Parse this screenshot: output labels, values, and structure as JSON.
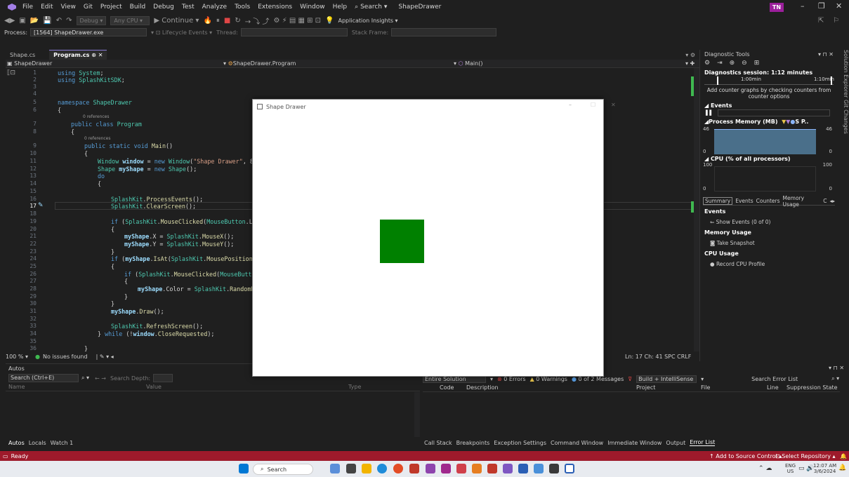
{
  "titlebar": {
    "menu": [
      "File",
      "Edit",
      "View",
      "Git",
      "Project",
      "Build",
      "Debug",
      "Test",
      "Analyze",
      "Tools",
      "Extensions",
      "Window",
      "Help"
    ],
    "search_label": "Search",
    "app_name": "ShapeDrawer",
    "avatar": "TN"
  },
  "toolbar": {
    "config": "Debug",
    "platform": "Any CPU",
    "continue_label": "Continue",
    "app_insights": "Application Insights"
  },
  "procbar": {
    "process_label": "Process:",
    "process_value": "[1564] ShapeDrawer.exe",
    "lifecycle": "Lifecycle Events",
    "thread": "Thread:",
    "stack_frame": "Stack Frame:"
  },
  "editor": {
    "tabs": [
      {
        "label": "Shape.cs"
      },
      {
        "label": "Program.cs"
      }
    ],
    "nav_project": "ShapeDrawer",
    "nav_class": "ShapeDrawer.Program",
    "nav_member": "Main()",
    "lines": [
      "1",
      "2",
      "3",
      "4",
      "5",
      "6",
      "7",
      "8",
      "9",
      "10",
      "11",
      "12",
      "13",
      "14",
      "15",
      "16",
      "17",
      "18",
      "19",
      "20",
      "21",
      "22",
      "23",
      "24",
      "25",
      "26",
      "27",
      "28",
      "29",
      "30",
      "31",
      "32",
      "33",
      "34",
      "35",
      "36"
    ],
    "refs_label": "0 references",
    "zoom": "100 %",
    "issues": "No issues found",
    "position": "Ln: 17   Ch: 41   SPC   CRLF"
  },
  "diag": {
    "title": "Diagnostic Tools",
    "session": "Diagnostics session: 1:12 minutes",
    "t1": "1:00min",
    "t2": "1:10min",
    "hint": "Add counter graphs by checking counters from counter options",
    "events": "Events",
    "memory_title": "Process Memory (MB)",
    "memory_legend": "S  P..",
    "mem_max": "46",
    "mem_min": "0",
    "cpu_title": "CPU (% of all processors)",
    "cpu_max": "100",
    "cpu_min": "0",
    "tabs": [
      "Summary",
      "Events",
      "Counters",
      "Memory Usage",
      "C"
    ],
    "sec_events": "Events",
    "show_events": "Show Events (0 of 0)",
    "sec_memory": "Memory Usage",
    "take_snapshot": "Take Snapshot",
    "sec_cpu": "CPU Usage",
    "record_cpu": "Record CPU Profile",
    "side_tabs": "Solution Explorer   Git Changes"
  },
  "autos": {
    "title": "Autos",
    "search_placeholder": "Search (Ctrl+E)",
    "search_depth": "Search Depth:",
    "col_name": "Name",
    "col_value": "Value",
    "col_type": "Type",
    "bottom_tabs": [
      "Autos",
      "Locals",
      "Watch 1"
    ]
  },
  "errors": {
    "scope": "Entire Solution",
    "errors": "0 Errors",
    "warnings": "0 Warnings",
    "messages": "0 of 2 Messages",
    "build": "Build + IntelliSense",
    "search": "Search Error List",
    "cols": [
      "Code",
      "Description",
      "Project",
      "File",
      "Line",
      "Suppression State"
    ],
    "bottom_tabs": [
      "Call Stack",
      "Breakpoints",
      "Exception Settings",
      "Command Window",
      "Immediate Window",
      "Output",
      "Error List"
    ]
  },
  "statusbar": {
    "ready": "Ready",
    "source_control": "Add to Source Control",
    "repo": "Select Repository"
  },
  "taskbar": {
    "search": "Search",
    "lang": "ENG",
    "region": "US",
    "time": "12:07 AM",
    "date": "3/6/2024"
  },
  "shape_window": {
    "title": "Shape Drawer",
    "square_color": "#008000"
  },
  "colors": {
    "status_bar": "#9e1a2b",
    "accent": "#8a7ad6"
  }
}
